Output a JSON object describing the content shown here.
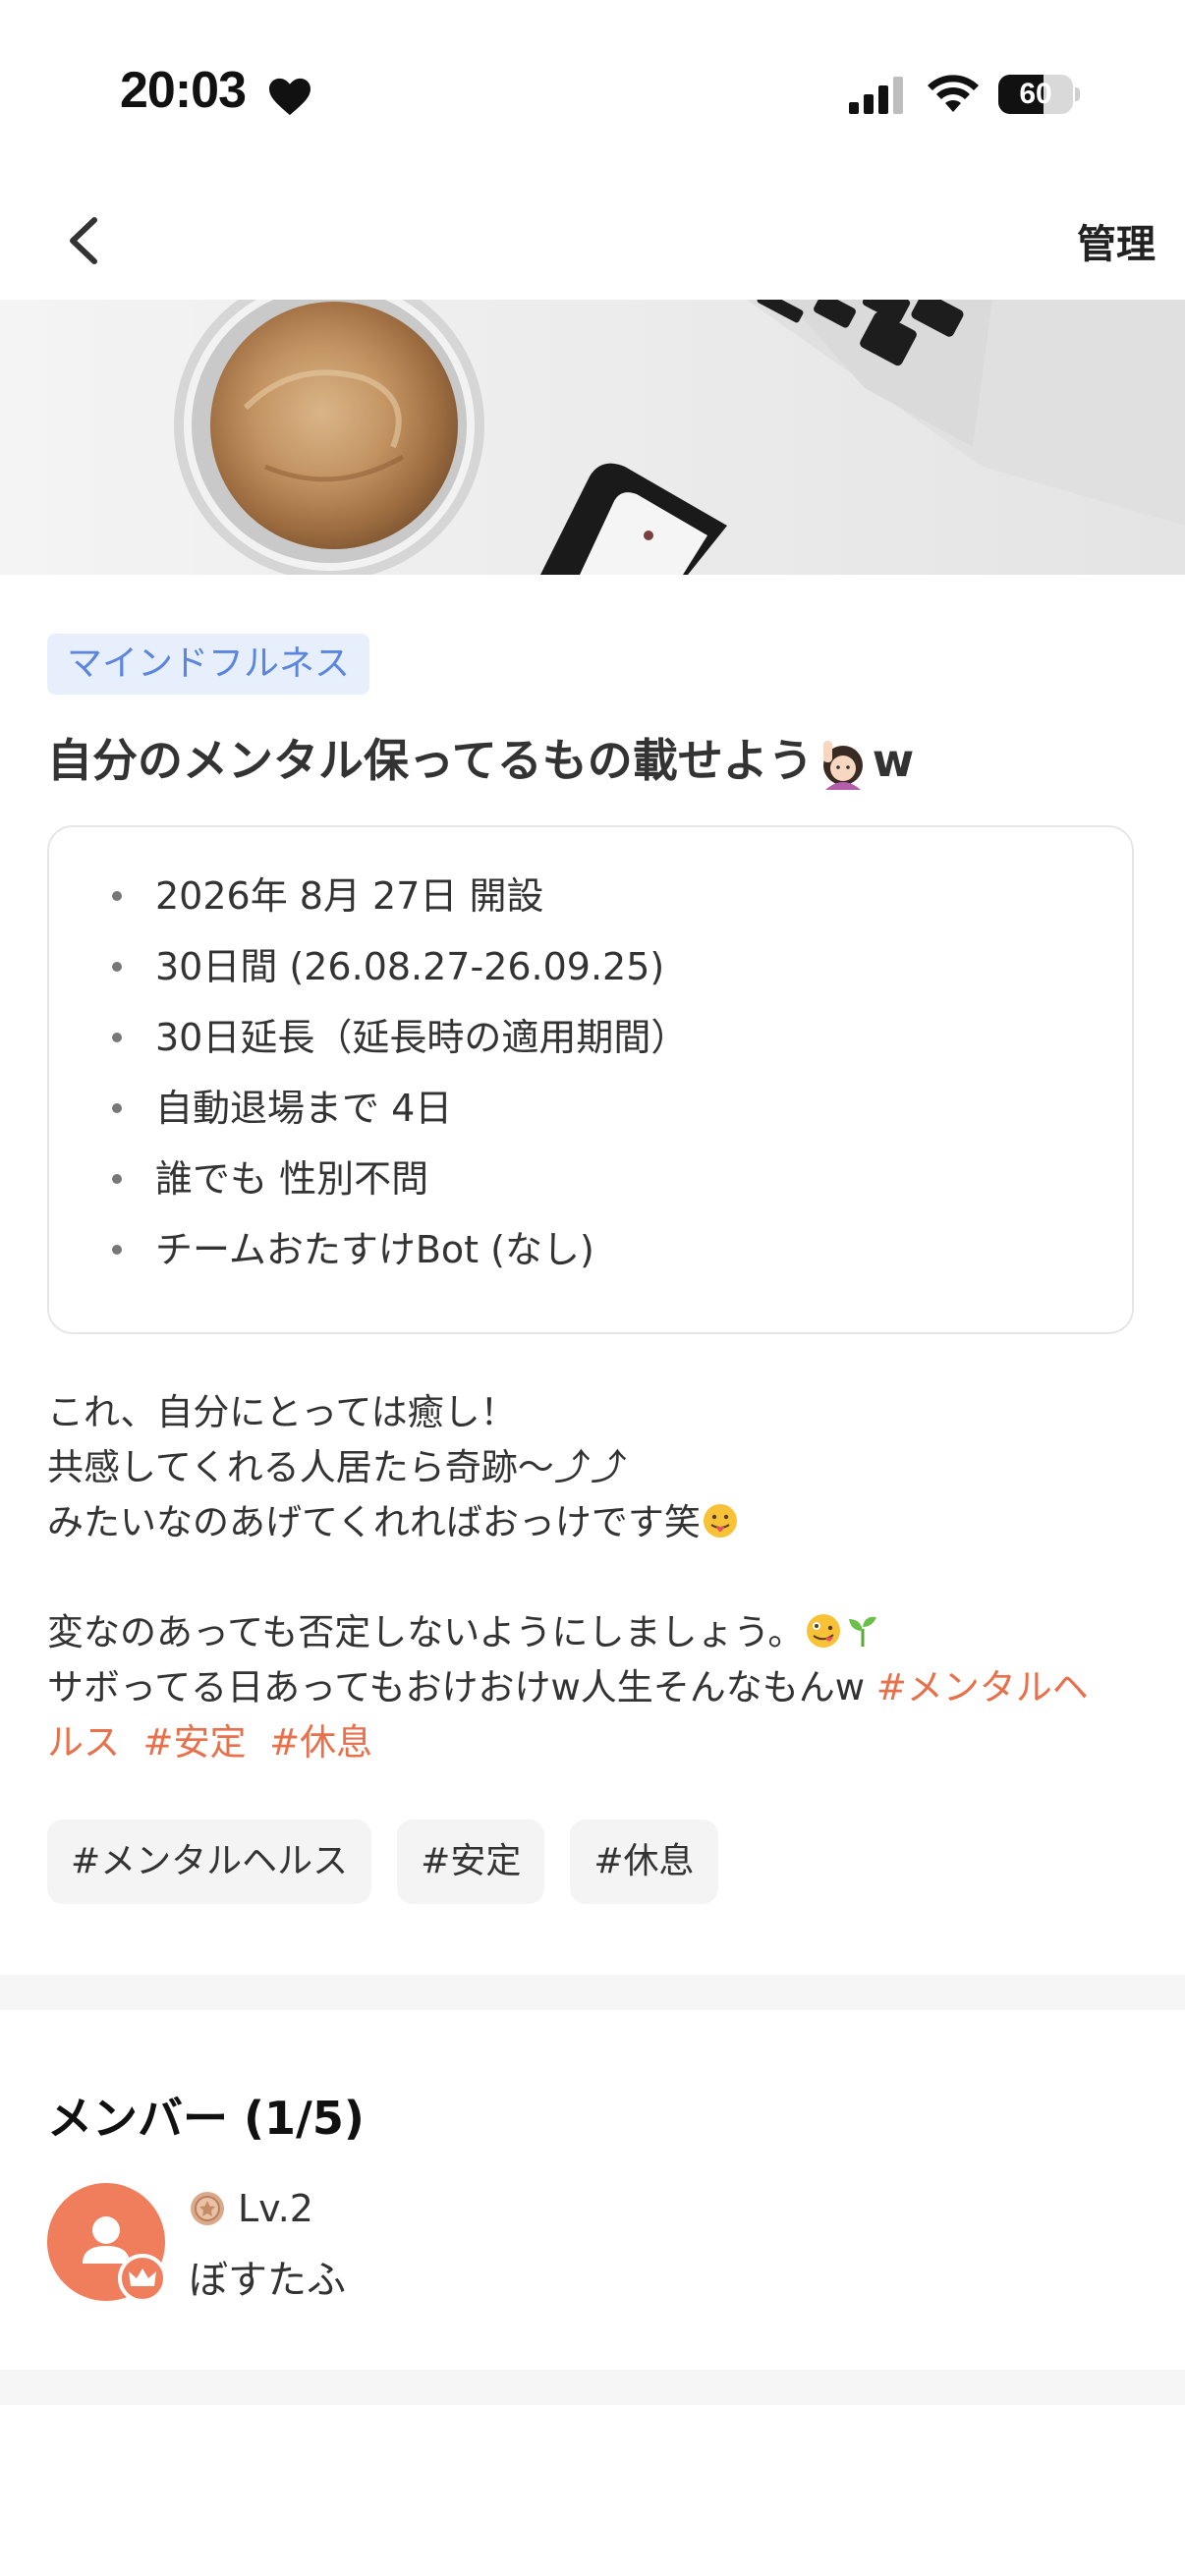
{
  "status_bar": {
    "time": "20:03",
    "battery": "60",
    "battery_level_percent": 60
  },
  "nav": {
    "manage_label": "管理"
  },
  "team": {
    "category": "マインドフルネス",
    "title_before_emoji": "自分のメンタル保ってるもの載せよう",
    "title_after_emoji": "w",
    "title_emoji_icon": "woman-raising-hand-emoji"
  },
  "info": {
    "items": [
      "2026年 8月 27日 開設",
      "30日間 (26.08.27-26.09.25)",
      "30日延長（延長時の適用期間）",
      "自動退場まで 4日",
      "誰でも 性別不問",
      "チームおたすけBot (なし)"
    ]
  },
  "description": {
    "line1": "これ、自分にとっては癒し！",
    "line2": "共感してくれる人居たら奇跡〜⤴︎⤴︎",
    "line3": "みたいなのあげてくれればおっけです笑",
    "line5": "変なのあっても否定しないようにしましょう。",
    "line6": "サボってる日あってもおけおけw人生そんなもんw ",
    "line6_hashtag": "#メンタルヘ",
    "line7_hashtag1": "ルス",
    "line7_hashtag2": "#安定",
    "line7_hashtag3": "#休息",
    "colors": {
      "hashtag": "#e8704a"
    }
  },
  "tags": [
    "#メンタルヘルス",
    "#安定",
    "#休息"
  ],
  "members": {
    "title": "メンバー (1/5)",
    "list": [
      {
        "level": "Lv.2",
        "name": "ぼすたふ",
        "avatar_color": "#f07e5c",
        "badge": "crown-icon"
      }
    ]
  }
}
